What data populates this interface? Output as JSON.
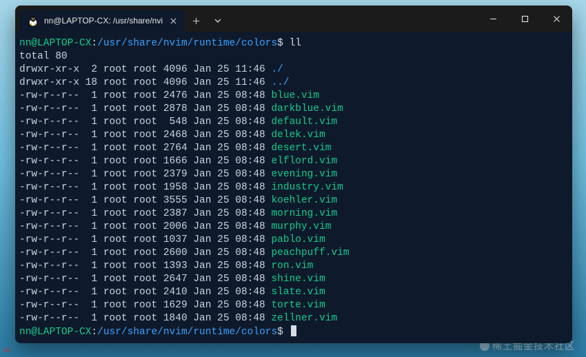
{
  "desktop": {
    "tag": "sd",
    "watermark": "稀土掘金技术社区"
  },
  "window": {
    "tab_title": "nn@LAPTOP-CX: /usr/share/nvi"
  },
  "prompt": {
    "user_host": "nn@LAPTOP-CX",
    "path": "/usr/share/nvim/runtime/colors",
    "symbol": "$",
    "command": "ll"
  },
  "listing": {
    "total_line": "total 80",
    "rows": [
      {
        "perm": "drwxr-xr-x",
        "links": " 2",
        "owner": "root",
        "group": "root",
        "size": "4096",
        "date": "Jan 25 11:46",
        "name": "./",
        "kind": "dir"
      },
      {
        "perm": "drwxr-xr-x",
        "links": "18",
        "owner": "root",
        "group": "root",
        "size": "4096",
        "date": "Jan 25 11:46",
        "name": "../",
        "kind": "dir"
      },
      {
        "perm": "-rw-r--r--",
        "links": " 1",
        "owner": "root",
        "group": "root",
        "size": "2476",
        "date": "Jan 25 08:48",
        "name": "blue.vim",
        "kind": "file"
      },
      {
        "perm": "-rw-r--r--",
        "links": " 1",
        "owner": "root",
        "group": "root",
        "size": "2878",
        "date": "Jan 25 08:48",
        "name": "darkblue.vim",
        "kind": "file"
      },
      {
        "perm": "-rw-r--r--",
        "links": " 1",
        "owner": "root",
        "group": "root",
        "size": " 548",
        "date": "Jan 25 08:48",
        "name": "default.vim",
        "kind": "file"
      },
      {
        "perm": "-rw-r--r--",
        "links": " 1",
        "owner": "root",
        "group": "root",
        "size": "2468",
        "date": "Jan 25 08:48",
        "name": "delek.vim",
        "kind": "file"
      },
      {
        "perm": "-rw-r--r--",
        "links": " 1",
        "owner": "root",
        "group": "root",
        "size": "2764",
        "date": "Jan 25 08:48",
        "name": "desert.vim",
        "kind": "file"
      },
      {
        "perm": "-rw-r--r--",
        "links": " 1",
        "owner": "root",
        "group": "root",
        "size": "1666",
        "date": "Jan 25 08:48",
        "name": "elflord.vim",
        "kind": "file"
      },
      {
        "perm": "-rw-r--r--",
        "links": " 1",
        "owner": "root",
        "group": "root",
        "size": "2379",
        "date": "Jan 25 08:48",
        "name": "evening.vim",
        "kind": "file"
      },
      {
        "perm": "-rw-r--r--",
        "links": " 1",
        "owner": "root",
        "group": "root",
        "size": "1958",
        "date": "Jan 25 08:48",
        "name": "industry.vim",
        "kind": "file"
      },
      {
        "perm": "-rw-r--r--",
        "links": " 1",
        "owner": "root",
        "group": "root",
        "size": "3555",
        "date": "Jan 25 08:48",
        "name": "koehler.vim",
        "kind": "file"
      },
      {
        "perm": "-rw-r--r--",
        "links": " 1",
        "owner": "root",
        "group": "root",
        "size": "2387",
        "date": "Jan 25 08:48",
        "name": "morning.vim",
        "kind": "file"
      },
      {
        "perm": "-rw-r--r--",
        "links": " 1",
        "owner": "root",
        "group": "root",
        "size": "2006",
        "date": "Jan 25 08:48",
        "name": "murphy.vim",
        "kind": "file"
      },
      {
        "perm": "-rw-r--r--",
        "links": " 1",
        "owner": "root",
        "group": "root",
        "size": "1037",
        "date": "Jan 25 08:48",
        "name": "pablo.vim",
        "kind": "file"
      },
      {
        "perm": "-rw-r--r--",
        "links": " 1",
        "owner": "root",
        "group": "root",
        "size": "2600",
        "date": "Jan 25 08:48",
        "name": "peachpuff.vim",
        "kind": "file"
      },
      {
        "perm": "-rw-r--r--",
        "links": " 1",
        "owner": "root",
        "group": "root",
        "size": "1393",
        "date": "Jan 25 08:48",
        "name": "ron.vim",
        "kind": "file"
      },
      {
        "perm": "-rw-r--r--",
        "links": " 1",
        "owner": "root",
        "group": "root",
        "size": "2647",
        "date": "Jan 25 08:48",
        "name": "shine.vim",
        "kind": "file"
      },
      {
        "perm": "-rw-r--r--",
        "links": " 1",
        "owner": "root",
        "group": "root",
        "size": "2410",
        "date": "Jan 25 08:48",
        "name": "slate.vim",
        "kind": "file"
      },
      {
        "perm": "-rw-r--r--",
        "links": " 1",
        "owner": "root",
        "group": "root",
        "size": "1629",
        "date": "Jan 25 08:48",
        "name": "torte.vim",
        "kind": "file"
      },
      {
        "perm": "-rw-r--r--",
        "links": " 1",
        "owner": "root",
        "group": "root",
        "size": "1840",
        "date": "Jan 25 08:48",
        "name": "zellner.vim",
        "kind": "file"
      }
    ]
  }
}
